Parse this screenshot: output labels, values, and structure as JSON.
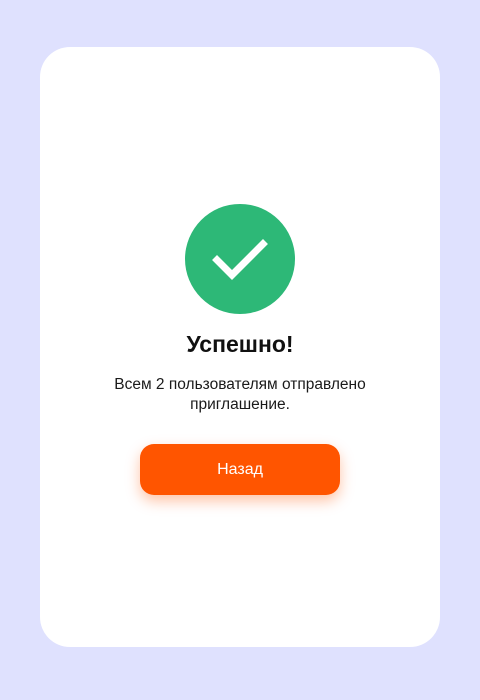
{
  "dialog": {
    "title": "Успешно!",
    "message": "Всем 2 пользователям отправлено приглашение.",
    "back_label": "Назад",
    "status_icon": "checkmark-icon"
  },
  "colors": {
    "page_background": "#dfe1fe",
    "success_green": "#2db877",
    "accent_orange": "#ff5500"
  }
}
